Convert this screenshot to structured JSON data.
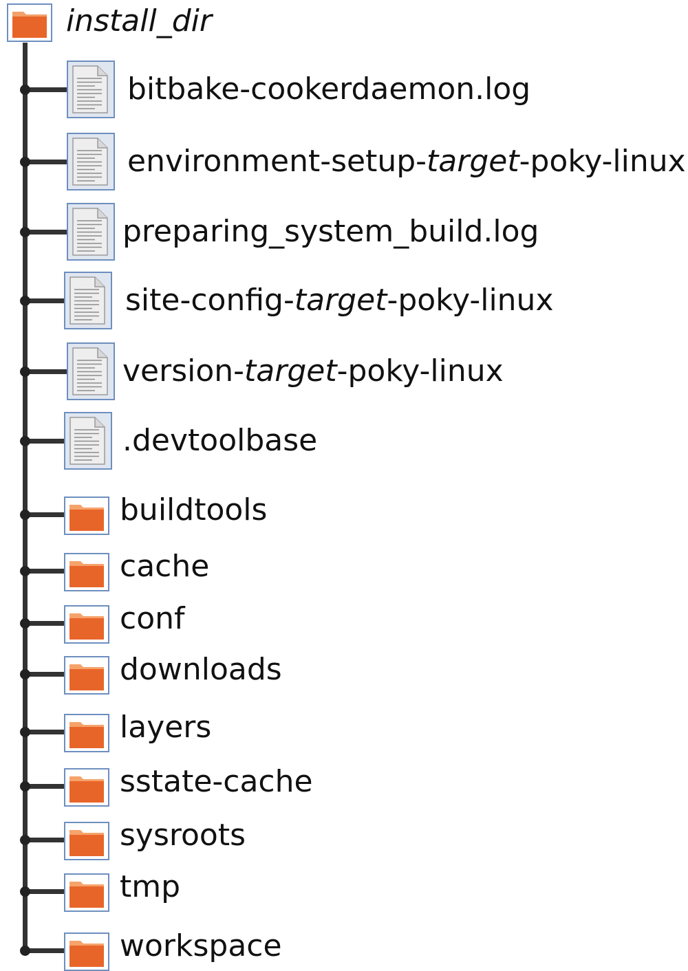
{
  "root": {
    "name": "install_dir",
    "icon": "folder-icon"
  },
  "files": [
    {
      "parts": [
        {
          "text": "bitbake-cookerdaemon.log",
          "italic": false
        }
      ],
      "icon": "document-icon"
    },
    {
      "parts": [
        {
          "text": "environment-setup-",
          "italic": false
        },
        {
          "text": "target",
          "italic": true
        },
        {
          "text": "-poky-linux",
          "italic": false
        }
      ],
      "icon": "document-icon"
    },
    {
      "parts": [
        {
          "text": "preparing_system_build.log",
          "italic": false
        }
      ],
      "icon": "document-icon"
    },
    {
      "parts": [
        {
          "text": "site-config-",
          "italic": false
        },
        {
          "text": "target",
          "italic": true
        },
        {
          "text": "-poky-linux",
          "italic": false
        }
      ],
      "icon": "document-icon"
    },
    {
      "parts": [
        {
          "text": "version-",
          "italic": false
        },
        {
          "text": "target",
          "italic": true
        },
        {
          "text": "-poky-linux",
          "italic": false
        }
      ],
      "icon": "document-icon"
    },
    {
      "parts": [
        {
          "text": ".devtoolbase",
          "italic": false
        }
      ],
      "icon": "document-icon"
    }
  ],
  "folders": [
    {
      "name": "buildtools",
      "icon": "folder-icon"
    },
    {
      "name": "cache",
      "icon": "folder-icon"
    },
    {
      "name": "conf",
      "icon": "folder-icon"
    },
    {
      "name": "downloads",
      "icon": "folder-icon"
    },
    {
      "name": "layers",
      "icon": "folder-icon"
    },
    {
      "name": "sstate-cache",
      "icon": "folder-icon"
    },
    {
      "name": "sysroots",
      "icon": "folder-icon"
    },
    {
      "name": "tmp",
      "icon": "folder-icon"
    },
    {
      "name": "workspace",
      "icon": "folder-icon"
    }
  ],
  "colors": {
    "tree_line": "#333333",
    "folder_orange": "#e8652a",
    "folder_light": "#f6a36b",
    "icon_border": "#6d8fbf",
    "doc_fill": "#eeeeee"
  }
}
